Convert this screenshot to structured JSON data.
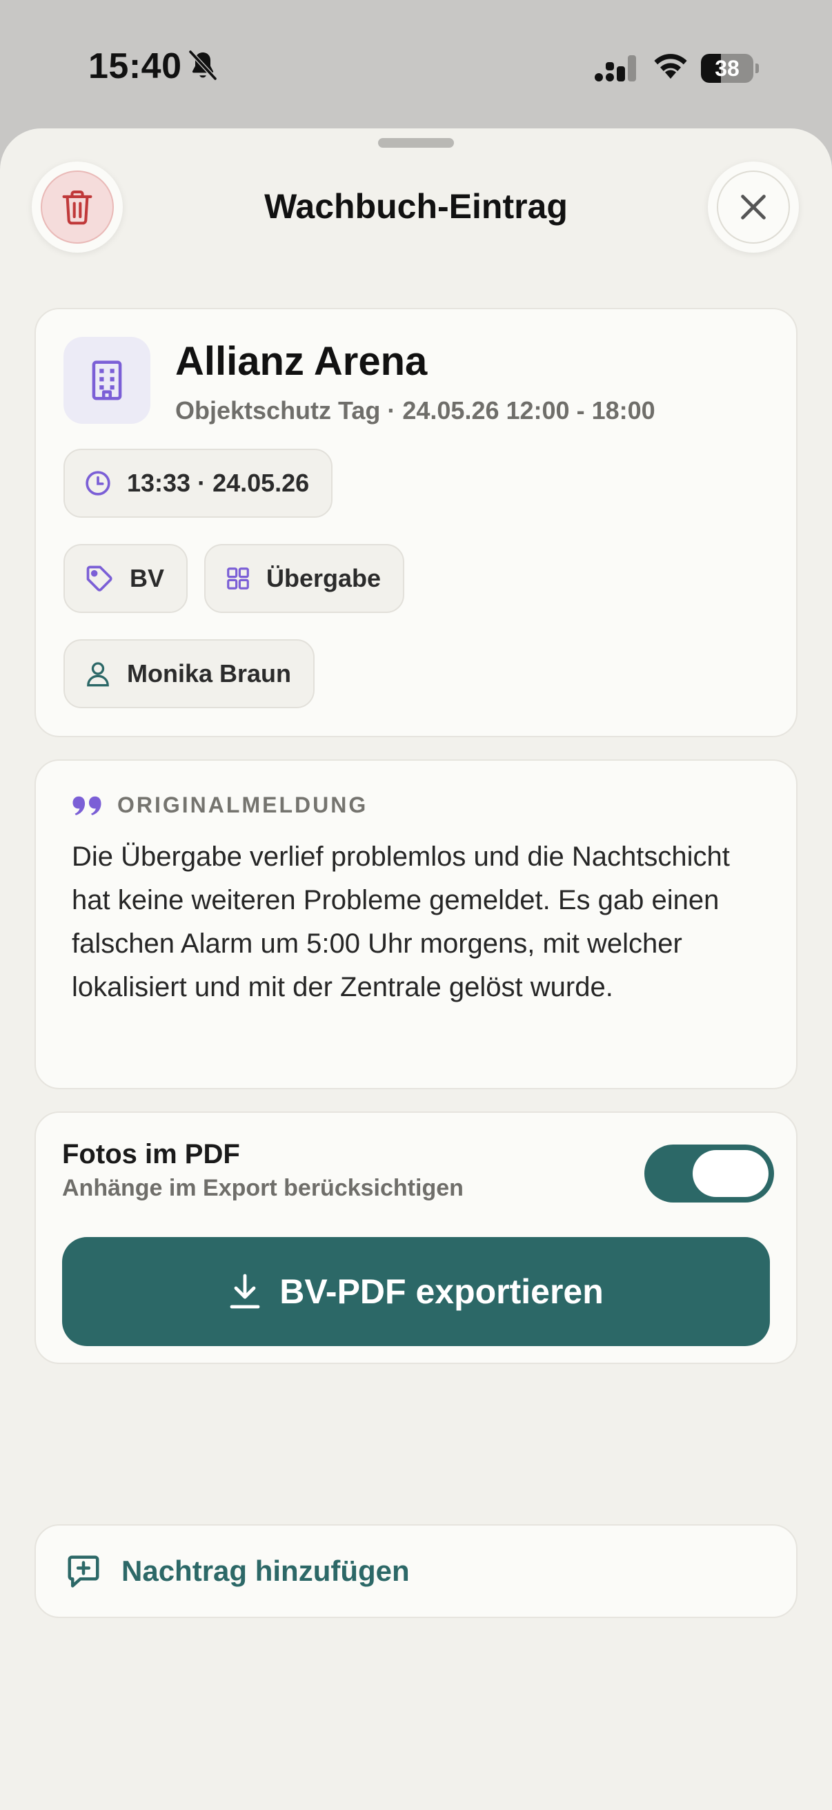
{
  "status_bar": {
    "time": "15:40",
    "battery": "38",
    "battery_level": 0.38,
    "icons": [
      "bell-slash-icon",
      "cellular-signal-icon",
      "wifi-icon",
      "battery-icon"
    ]
  },
  "header": {
    "title": "Wachbuch-Eintrag",
    "delete_icon": "trash-icon",
    "close_icon": "close-icon"
  },
  "object": {
    "name": "Allianz Arena",
    "subtitle": "Objektschutz Tag · 24.05.26 12:00 - 18:00",
    "icon": "building-icon",
    "chips": {
      "time": "13:33 · 24.05.26",
      "category": "BV",
      "type": "Übergabe",
      "person": "Monika Braun"
    }
  },
  "original": {
    "label": "ORIGINALMELDUNG",
    "text": "Die Übergabe verlief problemlos und die Nachtschicht hat keine weiteren Probleme gemeldet. Es gab einen falschen Alarm um 5:00 Uhr morgens, mit welcher lokalisiert und mit der Zentrale gelöst wurde."
  },
  "export": {
    "title": "Fotos im PDF",
    "subtitle": "Anhänge im Export berücksichtigen",
    "toggle_on": true,
    "button_label": "BV-PDF exportieren"
  },
  "nachtrag": {
    "label": "Nachtrag hinzufügen"
  },
  "colors": {
    "accent": "#2c6867",
    "purple": "#7b5fd6",
    "danger": "#c0393a",
    "sheet_bg": "#f2f1ec"
  }
}
